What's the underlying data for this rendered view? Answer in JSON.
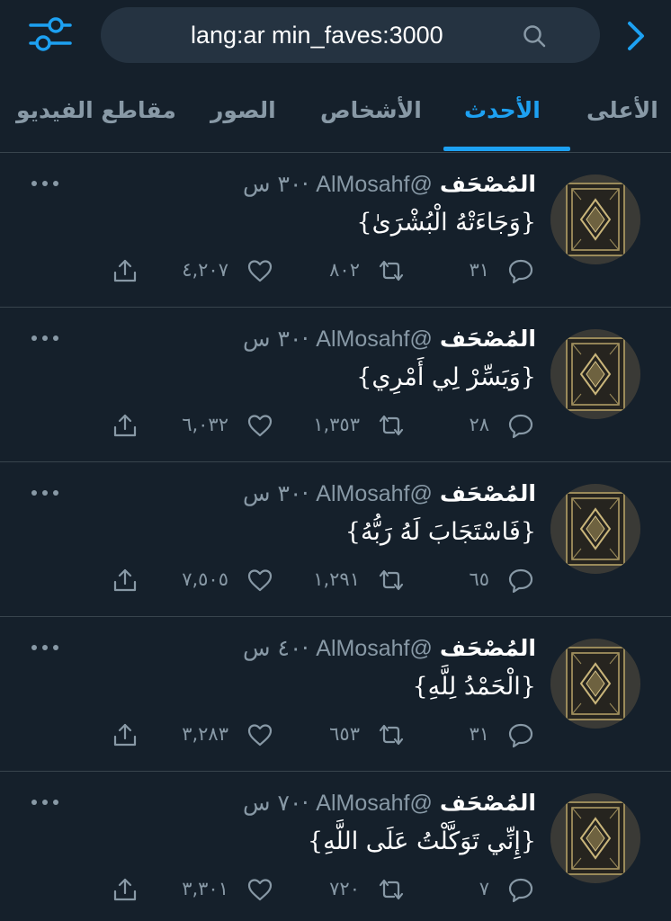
{
  "search": {
    "query": "lang:ar min_faves:3000",
    "filter_icon": "sliders-icon",
    "search_icon": "search-icon",
    "back_icon": "chevron-right-icon"
  },
  "tabs": [
    {
      "label": "الأعلى",
      "active": false
    },
    {
      "label": "الأحدث",
      "active": true
    },
    {
      "label": "الأشخاص",
      "active": false
    },
    {
      "label": "الصور",
      "active": false
    },
    {
      "label": "مقاطع الفيديو",
      "active": false
    }
  ],
  "colors": {
    "background": "#15202b",
    "accent": "#1da1f2",
    "muted": "#8899a6",
    "divider": "#38444d"
  },
  "tweets": [
    {
      "name": "المُصْحَف",
      "handle": "@AlMosahf",
      "time": "٣٠ س",
      "text": "{وَجَاءَتْهُ الْبُشْرَىٰ}",
      "replies": "٣١",
      "retweets": "٨٠٢",
      "likes": "٤,٢٠٧"
    },
    {
      "name": "المُصْحَف",
      "handle": "@AlMosahf",
      "time": "٣٠ س",
      "text": "{وَيَسِّرْ لِي أَمْرِي}",
      "replies": "٢٨",
      "retweets": "١,٣٥٣",
      "likes": "٦,٠٣٢"
    },
    {
      "name": "المُصْحَف",
      "handle": "@AlMosahf",
      "time": "٣٠ س",
      "text": "{فَاسْتَجَابَ لَهُ رَبُّهُ}",
      "replies": "٦٥",
      "retweets": "١,٢٩١",
      "likes": "٧,٥٠٥"
    },
    {
      "name": "المُصْحَف",
      "handle": "@AlMosahf",
      "time": "٤٠ س",
      "text": "{الْحَمْدُ لِلَّهِ}",
      "replies": "٣١",
      "retweets": "٦٥٣",
      "likes": "٣,٢٨٣"
    },
    {
      "name": "المُصْحَف",
      "handle": "@AlMosahf",
      "time": "٧٠ س",
      "text": "{إِنِّي تَوَكَّلْتُ عَلَى اللَّهِ}",
      "replies": "٧",
      "retweets": "٧٢٠",
      "likes": "٣,٣٠١"
    }
  ]
}
